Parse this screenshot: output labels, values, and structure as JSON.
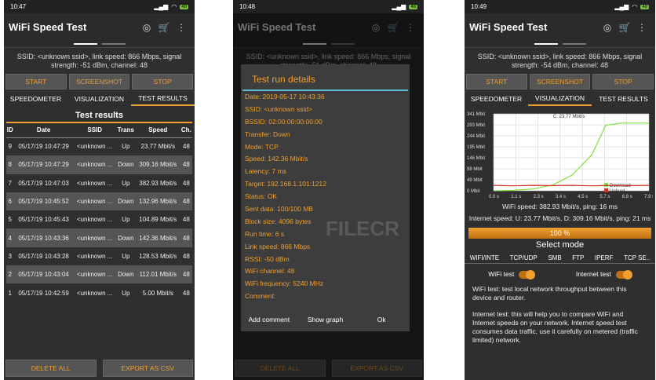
{
  "s1": {
    "time": "10:47",
    "battery": "48"
  },
  "s2": {
    "time": "10:48",
    "battery": "48"
  },
  "s3": {
    "time": "10:49",
    "battery": "48"
  },
  "app_title": "WiFi Speed Test",
  "ssid1": "SSID: <unknown ssid>, link speed: 866 Mbps, signal strength: -51 dBm, channel: 48",
  "ssid3": "SSID: <unknown ssid>, link speed: 866 Mbps, signal strength: -54 dBm, channel: 48",
  "buttons": {
    "start": "START",
    "screenshot": "SCREENSHOT",
    "stop": "STOP",
    "delete": "DELETE ALL",
    "export": "EXPORT AS CSV"
  },
  "tabs": {
    "speedometer": "SPEEDOMETER",
    "visualization": "VISUALIZATION",
    "results": "TEST RESULTS"
  },
  "results_title": "Test results",
  "columns": [
    "ID",
    "Date",
    "SSID",
    "Trans",
    "Speed",
    "Ch."
  ],
  "rows": [
    {
      "id": "9",
      "date": "05/17/19 10:47:29",
      "ssid": "<unknown ...",
      "trans": "Up",
      "speed": "23.77 Mbit/s",
      "ch": "48"
    },
    {
      "id": "8",
      "date": "05/17/19 10:47:29",
      "ssid": "<unknown ...",
      "trans": "Down",
      "speed": "309.16 Mbit/s",
      "ch": "48"
    },
    {
      "id": "7",
      "date": "05/17/19 10:47:03",
      "ssid": "<unknown ...",
      "trans": "Up",
      "speed": "382.93 Mbit/s",
      "ch": "48"
    },
    {
      "id": "6",
      "date": "05/17/19 10:45:52",
      "ssid": "<unknown ...",
      "trans": "Down",
      "speed": "132.96 Mbit/s",
      "ch": "48"
    },
    {
      "id": "5",
      "date": "05/17/19 10:45:43",
      "ssid": "<unknown ...",
      "trans": "Up",
      "speed": "104.89 Mbit/s",
      "ch": "48"
    },
    {
      "id": "4",
      "date": "05/17/19 10:43:36",
      "ssid": "<unknown ...",
      "trans": "Down",
      "speed": "142.36 Mbit/s",
      "ch": "48"
    },
    {
      "id": "3",
      "date": "05/17/19 10:43:28",
      "ssid": "<unknown ...",
      "trans": "Up",
      "speed": "128.53 Mbit/s",
      "ch": "48"
    },
    {
      "id": "2",
      "date": "05/17/19 10:43:04",
      "ssid": "<unknown ...",
      "trans": "Down",
      "speed": "112.01 Mbit/s",
      "ch": "48"
    },
    {
      "id": "1",
      "date": "05/17/19 10:42:59",
      "ssid": "<unknown ...",
      "trans": "Up",
      "speed": "5.00 Mbit/s",
      "ch": "48"
    }
  ],
  "dialog": {
    "title": "Test run details",
    "lines": [
      "Date: 2019-05-17 10:43:36",
      "SSID: <unknown ssid>",
      "BSSID: 02:00:00:00:00:00",
      "Transfer: Down",
      "Mode: TCP",
      "Speed: 142.36 Mbit/s",
      "Latency: 7 ms",
      "Target: 192.168.1.101:1212",
      "Status: OK",
      "Sent data: 100/100 MB",
      "Block size: 4096 bytes",
      "Run time: 6 s",
      "Link speed: 866 Mbps",
      "RSSI: -50 dBm",
      "WiFi channel: 48",
      "WiFi frequency: 5240 MHz",
      "Comment:"
    ],
    "add": "Add comment",
    "graph": "Show graph",
    "ok": "Ok"
  },
  "watermark": "FILECR",
  "chart_data": {
    "type": "line",
    "yticks": [
      "341 Mbit",
      "293 Mbit",
      "244 Mbit",
      "195 Mbit",
      "146 Mbit",
      "98 Mbit",
      "49 Mbit",
      "0 Mbit"
    ],
    "xticks": [
      "0.0 s",
      "1.1 s",
      "2.3 s",
      "3.4 s",
      "4.5 s",
      "5.7 s",
      "6.8 s",
      "7.9 s"
    ],
    "current": "C: 23.77 Mbit/s",
    "series": [
      {
        "name": "Download",
        "color": "#7ee040",
        "x": [
          0,
          1,
          2,
          3,
          4,
          5,
          5.7,
          6.5,
          7.9
        ],
        "y": [
          0,
          2,
          8,
          25,
          70,
          160,
          290,
          300,
          300
        ]
      },
      {
        "name": "Upload",
        "color": "#d03020",
        "x": [
          0,
          1,
          2,
          3,
          4,
          5,
          6,
          7,
          7.9
        ],
        "y": [
          24,
          22,
          24,
          23,
          24,
          22,
          24,
          23,
          24
        ]
      }
    ]
  },
  "wifi_speed": "WiFi speed: 382.93 Mbit/s, ping: 16 ms",
  "internet_speed": "Internet speed: U: 23.77 Mbit/s, D: 309.16 Mbit/s, ping: 21 ms",
  "progress": "100 %",
  "select_mode": "Select mode",
  "modes": [
    "WIFI/INTE",
    "TCP/UDP",
    "SMB",
    "FTP",
    "IPERF",
    "TCP SE.."
  ],
  "wifi_test": "WiFi test",
  "internet_test": "Internet test",
  "desc1": "WiFi test: test local network throughput between this device and router.",
  "desc2": "Internet test: this will help you to compare WiFi and Internet speeds on your network. Internet speed test consumes data traffic, use it carefully on metered (traffic limited) network."
}
